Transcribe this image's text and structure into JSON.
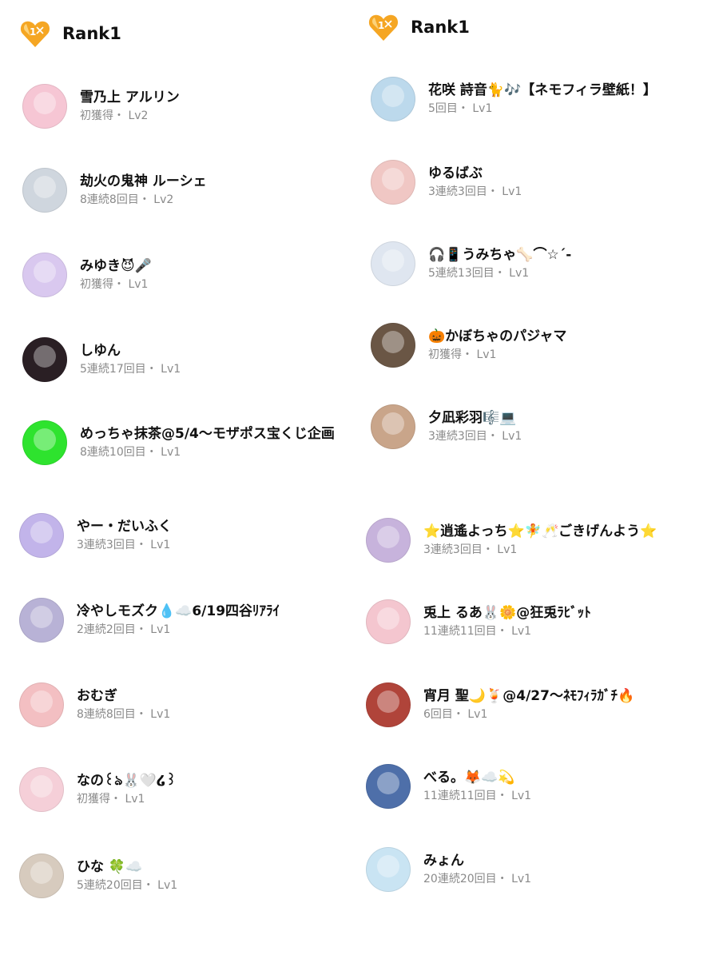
{
  "left": {
    "rank_label": "Rank1",
    "entries": [
      {
        "name": "雪乃上 アルリン",
        "sub": "初獲得・ Lv2",
        "avatar_color": "#f6c6d4"
      },
      {
        "name": "劫火の鬼神 ルーシェ",
        "sub": "8連続8回目・ Lv2",
        "avatar_color": "#cfd6de"
      },
      {
        "name": "みゆき😈🎤",
        "sub": "初獲得・ Lv1",
        "avatar_color": "#d9c8ef"
      },
      {
        "name": "しゆん",
        "sub": "5連続17回目・ Lv1",
        "avatar_color": "#2a1f24"
      },
      {
        "name": "めっちゃ抹茶@5/4〜モザポス宝くじ企画",
        "sub": "8連続10回目・ Lv1",
        "avatar_color": "#2ee32e"
      },
      {
        "name": "やー・だいふく",
        "sub": "3連続3回目・ Lv1",
        "avatar_color": "#c2b4ea"
      },
      {
        "name": "冷やしモズク💧☁️6/19四谷ﾘｱﾗｲ",
        "sub": "2連続2回目・ Lv1",
        "avatar_color": "#b8b2d6"
      },
      {
        "name": "おむぎ",
        "sub": "8連続8回目・ Lv1",
        "avatar_color": "#f3bfc2"
      },
      {
        "name": "なの꒰ঌ🐰🤍໒꒱",
        "sub": "初獲得・ Lv1",
        "avatar_color": "#f5cfd8"
      },
      {
        "name": "ひな 🍀☁️",
        "sub": "5連続20回目・ Lv1",
        "avatar_color": "#d7cbbe"
      }
    ]
  },
  "right": {
    "rank_label": "Rank1",
    "entries": [
      {
        "name": "花咲 詩音🐈🎶【ネモフィラ壁紙！】",
        "sub": "5回目・ Lv1",
        "avatar_color": "#bcd9ec"
      },
      {
        "name": "ゆるばぶ",
        "sub": "3連続3回目・ Lv1",
        "avatar_color": "#f0c7c4"
      },
      {
        "name": "🎧📱うみちゃ🦴⌒☆´-",
        "sub": "5連続13回目・ Lv1",
        "avatar_color": "#dfe6f0"
      },
      {
        "name": "🎃かぼちゃのパジャマ",
        "sub": "初獲得・ Lv1",
        "avatar_color": "#6a5645"
      },
      {
        "name": "夕凪彩羽🎼💻",
        "sub": "3連続3回目・ Lv1",
        "avatar_color": "#c9a58a"
      },
      {
        "name": "⭐逍遙よっち⭐🧚🥂ごきげんよう⭐",
        "sub": "3連続3回目・ Lv1",
        "avatar_color": "#c7b3dc"
      },
      {
        "name": "兎上 るあ🐰🌼@狂兎ﾗﾋﾞｯﾄ",
        "sub": "11連続11回目・ Lv1",
        "avatar_color": "#f4c6cf"
      },
      {
        "name": "宵月 聖🌙🍹@4/27〜ﾈﾓﾌｨﾗｶﾞﾁ🔥",
        "sub": "6回目・ Lv1",
        "avatar_color": "#b0443a"
      },
      {
        "name": "べる。🦊☁️💫",
        "sub": "11連続11回目・ Lv1",
        "avatar_color": "#4e6fa9"
      },
      {
        "name": "みょん",
        "sub": "20連続20回目・ Lv1",
        "avatar_color": "#c9e4f3"
      }
    ]
  },
  "colors": {
    "badge": "#f5a623",
    "badge_light": "#fcd27a",
    "subtext": "#8a8a8a"
  },
  "icons": {
    "rank_badge": "heart-rank-badge-icon"
  }
}
